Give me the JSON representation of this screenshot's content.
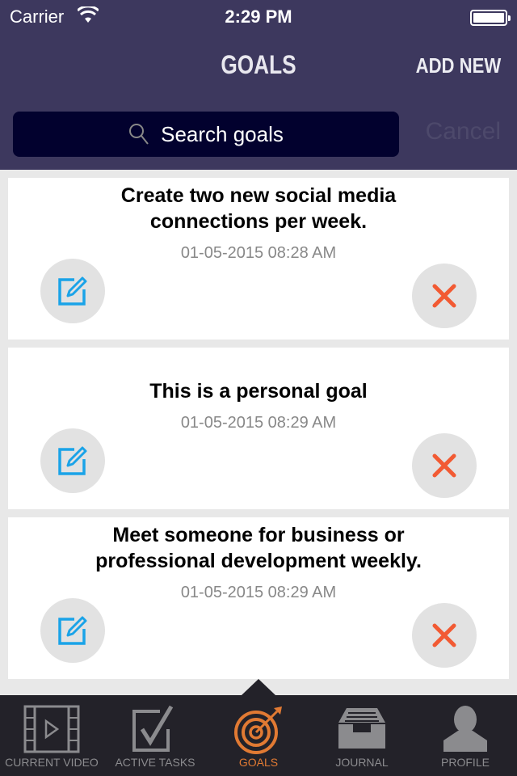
{
  "status_bar": {
    "carrier": "Carrier",
    "time": "2:29 PM"
  },
  "header": {
    "title": "GOALS",
    "add_new": "ADD NEW"
  },
  "search": {
    "placeholder": "Search goals",
    "cancel": "Cancel"
  },
  "goals": [
    {
      "title_line1": "Create two new social media",
      "title_line2": "connections per week.",
      "date": "01-05-2015 08:28 AM"
    },
    {
      "title_line1": "This is a personal goal",
      "title_line2": "",
      "date": "01-05-2015 08:29 AM"
    },
    {
      "title_line1": "Meet someone for business or",
      "title_line2": "professional development weekly.",
      "date": "01-05-2015 08:29 AM"
    }
  ],
  "tabs": [
    {
      "label": "CURRENT VIDEO",
      "icon": "film-icon"
    },
    {
      "label": "ACTIVE TASKS",
      "icon": "checkbox-icon"
    },
    {
      "label": "GOALS",
      "icon": "target-icon",
      "active": true
    },
    {
      "label": "JOURNAL",
      "icon": "inbox-tray-icon"
    },
    {
      "label": "PROFILE",
      "icon": "person-icon"
    }
  ],
  "colors": {
    "header": "#3d385e",
    "search_bg": "#02012e",
    "accent": "#e17a33",
    "edit": "#1aa3e8",
    "delete": "#f25a33"
  }
}
